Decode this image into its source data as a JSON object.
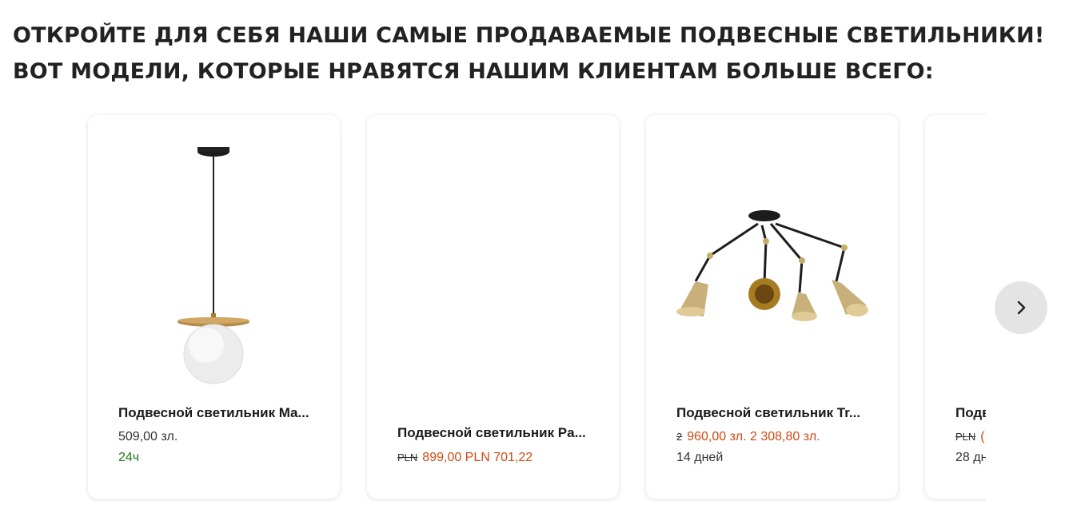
{
  "heading": {
    "line1": "ОТКРОЙТЕ ДЛЯ СЕБЯ НАШИ САМЫЕ ПРОДАВАЕМЫЕ ПОДВЕСНЫЕ СВЕТИЛЬНИКИ!",
    "line2": "ВОТ МОДЕЛИ, КОТОРЫЕ НРАВЯТСЯ НАШИМ КЛИЕНТАМ БОЛЬШЕ ВСЕГО:"
  },
  "products": [
    {
      "title": "Подвесной светильник Ma...",
      "old_price": "",
      "price": "509,00 зл.",
      "delivery": "24ч"
    },
    {
      "title": "Подвесной светильник Pa...",
      "old_price": "PLN",
      "price": "899,00 PLN 701,22",
      "delivery": ""
    },
    {
      "title": "Подвесной светильник Tr...",
      "old_price": "2",
      "price": "960,00 зл. 2 308,80 зл.",
      "delivery": "14 дней"
    },
    {
      "title": "Подв",
      "old_price": "PLN",
      "price": "(",
      "delivery": "28 дн"
    }
  ],
  "icons": {
    "next": "chevron-right-icon"
  },
  "colors": {
    "sale": "#d04a11",
    "delivery_fast": "#1f7a1f",
    "next_button_bg": "#e4e4e4"
  }
}
